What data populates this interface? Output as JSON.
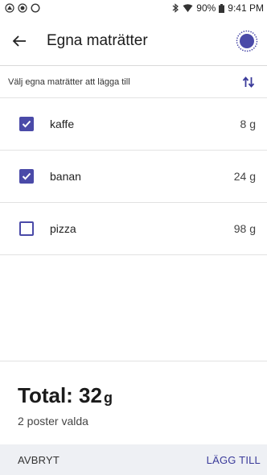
{
  "status_bar": {
    "battery": "90%",
    "time": "9:41 PM"
  },
  "appbar": {
    "title": "Egna maträtter"
  },
  "subheader": {
    "label": "Välj egna maträtter att lägga till"
  },
  "items": [
    {
      "name": "kaffe",
      "amount": "8 g",
      "checked": true
    },
    {
      "name": "banan",
      "amount": "24 g",
      "checked": true
    },
    {
      "name": "pizza",
      "amount": "98 g",
      "checked": false
    }
  ],
  "summary": {
    "total_label": "Total: 32",
    "unit": "g",
    "selected_text": "2 poster valda"
  },
  "footer": {
    "cancel_label": "AVBRYT",
    "add_label": "LÄGG TILL"
  },
  "colors": {
    "accent": "#4a4aa8",
    "footer_bg": "#eef0f4"
  }
}
